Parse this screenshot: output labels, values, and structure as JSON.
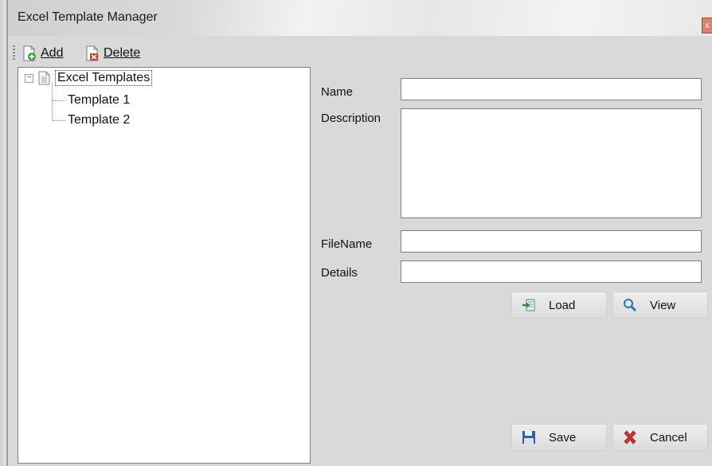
{
  "window": {
    "title": "Excel Template Manager",
    "close_glyph": "x"
  },
  "toolbar": {
    "add": {
      "label": "Add",
      "icon": "add-document-icon"
    },
    "delete": {
      "label": "Delete",
      "icon": "delete-document-icon"
    }
  },
  "tree": {
    "root_label": "Excel Templates",
    "expander": "−",
    "children": [
      "Template 1",
      "Template 2"
    ]
  },
  "form": {
    "name_label": "Name",
    "name_value": "",
    "description_label": "Description",
    "description_value": "",
    "filename_label": "FileName",
    "filename_value": "",
    "details_label": "Details",
    "details_value": ""
  },
  "buttons": {
    "load": "Load",
    "view": "View",
    "save": "Save",
    "cancel": "Cancel"
  },
  "colors": {
    "background": "#d9d9d9",
    "panel": "#ffffff",
    "close_button": "#d9846f"
  }
}
